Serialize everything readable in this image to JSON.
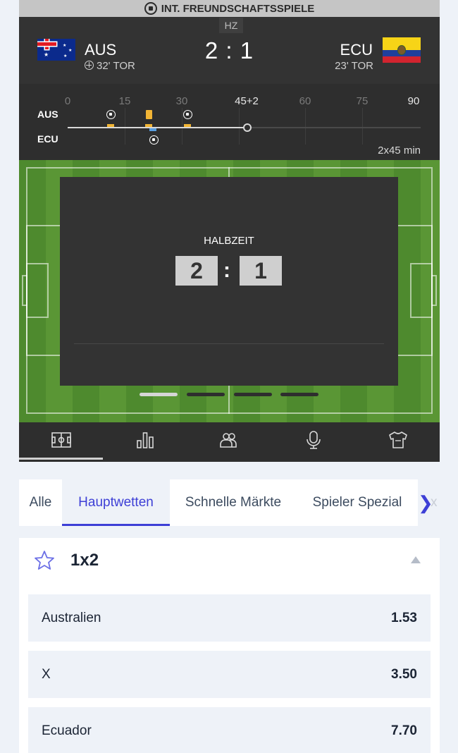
{
  "header": {
    "competition": "INT. FREUNDSCHAFTSSPIELE",
    "period": "HZ",
    "home": {
      "code": "AUS",
      "goal_info": "32' TOR"
    },
    "away": {
      "code": "ECU",
      "goal_info": "23' TOR"
    },
    "score": "2 : 1"
  },
  "timeline": {
    "ticks": [
      "0",
      "15",
      "30",
      "45+2",
      "60",
      "75",
      "90"
    ],
    "home_label": "AUS",
    "away_label": "ECU",
    "duration": "2x45 min"
  },
  "halftime": {
    "label": "HALBZEIT",
    "home_score": "2",
    "away_score": "1",
    "colon": ":"
  },
  "icon_tabs": [
    "pitch-icon",
    "stats-icon",
    "lineups-icon",
    "commentary-icon",
    "jersey-icon"
  ],
  "market_tabs": {
    "items": [
      "Alle",
      "Hauptwetten",
      "Schnelle Märkte",
      "Spieler Spezial"
    ],
    "active": "Hauptwetten",
    "more_hint": "x"
  },
  "market": {
    "title": "1x2",
    "outcomes": [
      {
        "name": "Australien",
        "odd": "1.53"
      },
      {
        "name": "X",
        "odd": "3.50"
      },
      {
        "name": "Ecuador",
        "odd": "7.70"
      }
    ]
  },
  "colors": {
    "accent": "#3d3fd6",
    "widget_bg": "#333333",
    "yellow_card": "#f2b535",
    "sub_marker": "#5a9fe0"
  }
}
